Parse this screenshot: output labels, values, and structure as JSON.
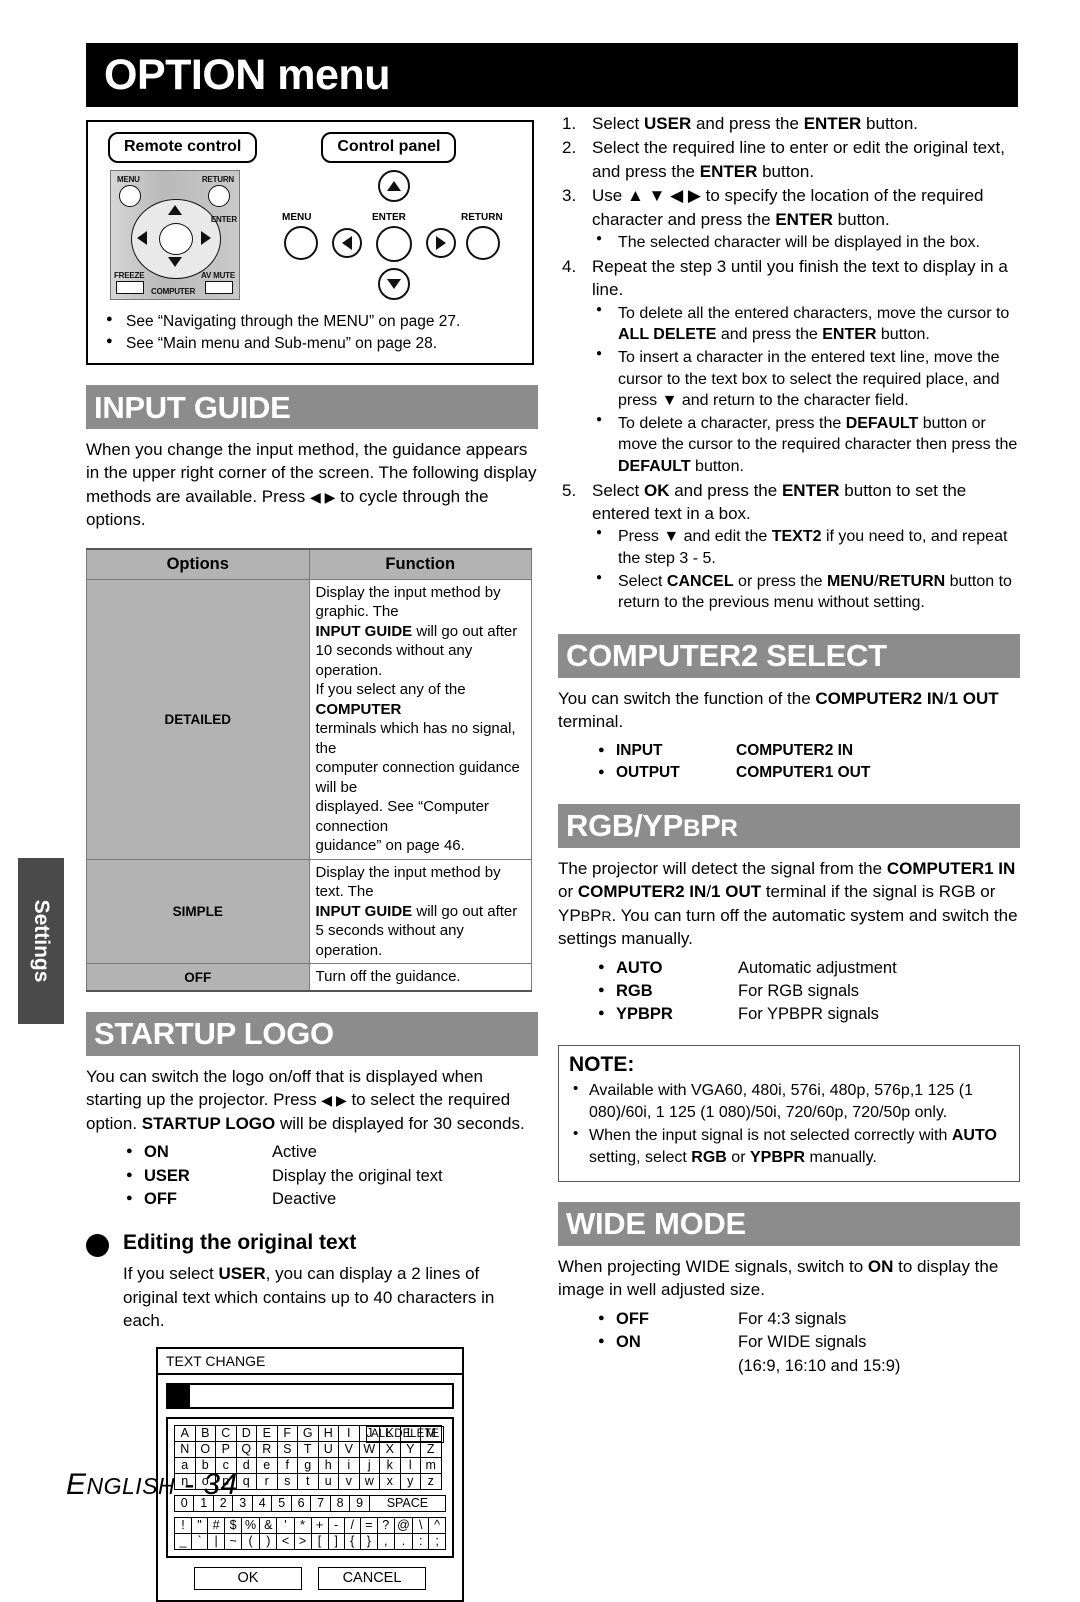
{
  "page": {
    "title": "OPTION menu",
    "footer_prefix": "E",
    "footer_rest": "NGLISH",
    "footer_page": " - 34",
    "side_tab": "Settings"
  },
  "nav_box": {
    "remote_label": "Remote control",
    "panel_label": "Control panel",
    "remote_buttons": {
      "menu": "MENU",
      "return": "RETURN",
      "enter": "ENTER",
      "freeze": "FREEZE",
      "av_mute": "AV MUTE",
      "computer": "COMPUTER"
    },
    "panel_buttons": {
      "menu": "MENU",
      "enter": "ENTER",
      "return": "RETURN"
    },
    "notes": [
      "See “Navigating through the MENU” on page 27.",
      "See “Main menu and Sub-menu” on page 28."
    ]
  },
  "input_guide": {
    "heading": "INPUT GUIDE",
    "paragraph_1": "When you change the input method, the guidance appears in the upper right corner of the screen. The following display methods are available. Press ",
    "paragraph_2": " to cycle through the options.",
    "table": {
      "headers": [
        "Options",
        "Function"
      ],
      "rows": [
        {
          "option": "DETAILED",
          "function_lines": [
            "Display the input method by graphic. The",
            "INPUT GUIDE|b| will go out after",
            "10 seconds without any operation.",
            "If you select any of the |b|COMPUTER",
            "terminals which has no signal, the",
            "computer connection guidance will be",
            "displayed. See “Computer connection",
            "guidance” on page 46."
          ]
        },
        {
          "option": "SIMPLE",
          "function_lines": [
            "Display the input method by text. The",
            "INPUT GUIDE|b| will go out after",
            "5 seconds without any operation."
          ]
        },
        {
          "option": "OFF",
          "function_lines": [
            "Turn off the guidance."
          ]
        }
      ]
    }
  },
  "startup_logo": {
    "heading": "STARTUP LOGO",
    "paragraph_a": "You can switch the logo on/off that is displayed when starting up the projector. Press ",
    "paragraph_b": " to select the required option. ",
    "paragraph_b_bold": "STARTUP LOGO",
    "paragraph_c": " will be displayed for 30 seconds.",
    "options": [
      {
        "key": "ON",
        "value": "Active"
      },
      {
        "key": "USER",
        "value": "Display the original text"
      },
      {
        "key": "OFF",
        "value": "Deactive"
      }
    ]
  },
  "editing_text": {
    "heading": "Editing the original text",
    "para_1": "If you select ",
    "para_bold": "USER",
    "para_2": ", you can display a 2 lines of original text which contains up to 40 characters in each.",
    "dialog": {
      "title": "TEXT CHANGE",
      "all_delete": "ALL DELETE",
      "rows_upper": [
        [
          "A",
          "B",
          "C",
          "D",
          "E",
          "F",
          "G",
          "H",
          "I",
          "J",
          "K",
          "L",
          "M"
        ],
        [
          "N",
          "O",
          "P",
          "Q",
          "R",
          "S",
          "T",
          "U",
          "V",
          "W",
          "X",
          "Y",
          "Z"
        ],
        [
          "a",
          "b",
          "c",
          "d",
          "e",
          "f",
          "g",
          "h",
          "i",
          "j",
          "k",
          "l",
          "m"
        ],
        [
          "n",
          "o",
          "p",
          "q",
          "r",
          "s",
          "t",
          "u",
          "v",
          "w",
          "x",
          "y",
          "z"
        ]
      ],
      "rows_numbers": [
        [
          "0",
          "1",
          "2",
          "3",
          "4",
          "5",
          "6",
          "7",
          "8",
          "9"
        ]
      ],
      "space_label": "SPACE",
      "rows_symbols": [
        [
          "!",
          "\"",
          "#",
          "$",
          "%",
          "&",
          "'",
          "*",
          "+",
          "-",
          "/",
          "=",
          "?",
          "@",
          "\\",
          "^"
        ],
        [
          "_",
          "`",
          "|",
          "~",
          "(",
          ")",
          "<",
          ">",
          "[",
          "]",
          "{",
          "}",
          ",",
          ".",
          ":",
          ";"
        ]
      ],
      "ok": "OK",
      "cancel": "CANCEL"
    }
  },
  "steps": [
    {
      "num": "1.",
      "parts": [
        {
          "t": "Select ",
          "b": false
        },
        {
          "t": "USER",
          "b": true
        },
        {
          "t": " and press the ",
          "b": false
        },
        {
          "t": "ENTER",
          "b": true
        },
        {
          "t": " button.",
          "b": false
        }
      ],
      "bullets": []
    },
    {
      "num": "2.",
      "parts": [
        {
          "t": "Select the required line to enter or edit the original text, and press the ",
          "b": false
        },
        {
          "t": "ENTER",
          "b": true
        },
        {
          "t": " button.",
          "b": false
        }
      ],
      "bullets": []
    },
    {
      "num": "3.",
      "parts": [
        {
          "t": "Use ",
          "b": false
        },
        {
          "t": "▲ ▼ ◀ ▶",
          "b": false
        },
        {
          "t": " to specify the location of the required character and press the ",
          "b": false
        },
        {
          "t": "ENTER",
          "b": true
        },
        {
          "t": " button.",
          "b": false
        }
      ],
      "bullets": [
        [
          {
            "t": "The selected character will be displayed in the box.",
            "b": false
          }
        ]
      ]
    },
    {
      "num": "4.",
      "parts": [
        {
          "t": "Repeat the step 3 until you finish the text to display in a line.",
          "b": false
        }
      ],
      "bullets": [
        [
          {
            "t": "To delete all the entered characters, move the cursor to ",
            "b": false
          },
          {
            "t": "ALL DELETE",
            "b": true
          },
          {
            "t": " and press the ",
            "b": false
          },
          {
            "t": "ENTER",
            "b": true
          },
          {
            "t": " button.",
            "b": false
          }
        ],
        [
          {
            "t": "To insert a character in the entered text line, move the cursor to the text box to select the required place, and press ▼ and return to the character field.",
            "b": false
          }
        ],
        [
          {
            "t": "To delete a character, press the ",
            "b": false
          },
          {
            "t": "DEFAULT",
            "b": true
          },
          {
            "t": " button or move the cursor to the required character then press the ",
            "b": false
          },
          {
            "t": "DEFAULT",
            "b": true
          },
          {
            "t": " button.",
            "b": false
          }
        ]
      ]
    },
    {
      "num": "5.",
      "parts": [
        {
          "t": "Select ",
          "b": false
        },
        {
          "t": "OK",
          "b": true
        },
        {
          "t": " and press the ",
          "b": false
        },
        {
          "t": "ENTER",
          "b": true
        },
        {
          "t": " button to set the entered text in a box.",
          "b": false
        }
      ],
      "bullets": [
        [
          {
            "t": "Press ▼ and edit the ",
            "b": false
          },
          {
            "t": "TEXT2",
            "b": true
          },
          {
            "t": " if you need to, and repeat the step 3 - 5.",
            "b": false
          }
        ],
        [
          {
            "t": "Select ",
            "b": false
          },
          {
            "t": "CANCEL",
            "b": true
          },
          {
            "t": " or press the ",
            "b": false
          },
          {
            "t": "MENU",
            "b": true
          },
          {
            "t": "/",
            "b": false
          },
          {
            "t": "RETURN",
            "b": true
          },
          {
            "t": " button to return to the previous menu without setting.",
            "b": false
          }
        ]
      ]
    }
  ],
  "computer2_select": {
    "heading": "COMPUTER2 SELECT",
    "para_1": "You can switch the function of the ",
    "para_bold_1": "COMPUTER2 IN",
    "para_2": "/",
    "para_bold_2": "1 OUT",
    "para_3": " terminal.",
    "options": [
      {
        "key": "INPUT",
        "value": "COMPUTER2 IN"
      },
      {
        "key": "OUTPUT",
        "value": "COMPUTER1 OUT"
      }
    ]
  },
  "rgb_ypbpr": {
    "heading_main": "RGB/YP",
    "heading_sub1": "B",
    "heading_mid": "P",
    "heading_sub2": "R",
    "para_1": "The projector will detect the signal from the ",
    "para_bold_1": "COMPUTER1 IN",
    "para_2": " or ",
    "para_bold_2": "COMPUTER2 IN",
    "para_3": "/",
    "para_bold_3": "1 OUT",
    "para_4": " terminal if the signal is RGB or YP",
    "para_sub_b": "B",
    "para_5": "P",
    "para_sub_r": "R",
    "para_6": ". You can turn off the automatic system and switch the settings manually.",
    "options": [
      {
        "key": "AUTO",
        "value": "Automatic adjustment"
      },
      {
        "key": "RGB",
        "value": "For RGB signals"
      },
      {
        "key": "YPBPR",
        "value": "For YPBPR signals"
      }
    ]
  },
  "note": {
    "title": "NOTE:",
    "items": [
      [
        {
          "t": "Available with VGA60, 480i, 576i, 480p, 576p,1 125 (1 080)/60i, 1 125 (1 080)/50i, 720/60p, 720/50p only.",
          "b": false
        }
      ],
      [
        {
          "t": "When the input signal is not selected correctly with ",
          "b": false
        },
        {
          "t": "AUTO",
          "b": true
        },
        {
          "t": " setting, select ",
          "b": false
        },
        {
          "t": "RGB",
          "b": true
        },
        {
          "t": " or ",
          "b": false
        },
        {
          "t": "YPBPR",
          "b": true
        },
        {
          "t": " manually.",
          "b": false
        }
      ]
    ]
  },
  "wide_mode": {
    "heading": "WIDE MODE",
    "para_1": "When projecting WIDE signals, switch to ",
    "para_bold": "ON",
    "para_2": " to display the image in well adjusted size.",
    "options": [
      {
        "key": "OFF",
        "value": "For 4:3 signals"
      },
      {
        "key": "ON",
        "value": "For WIDE signals"
      }
    ],
    "option_extra": "(16:9, 16:10 and 15:9)"
  }
}
